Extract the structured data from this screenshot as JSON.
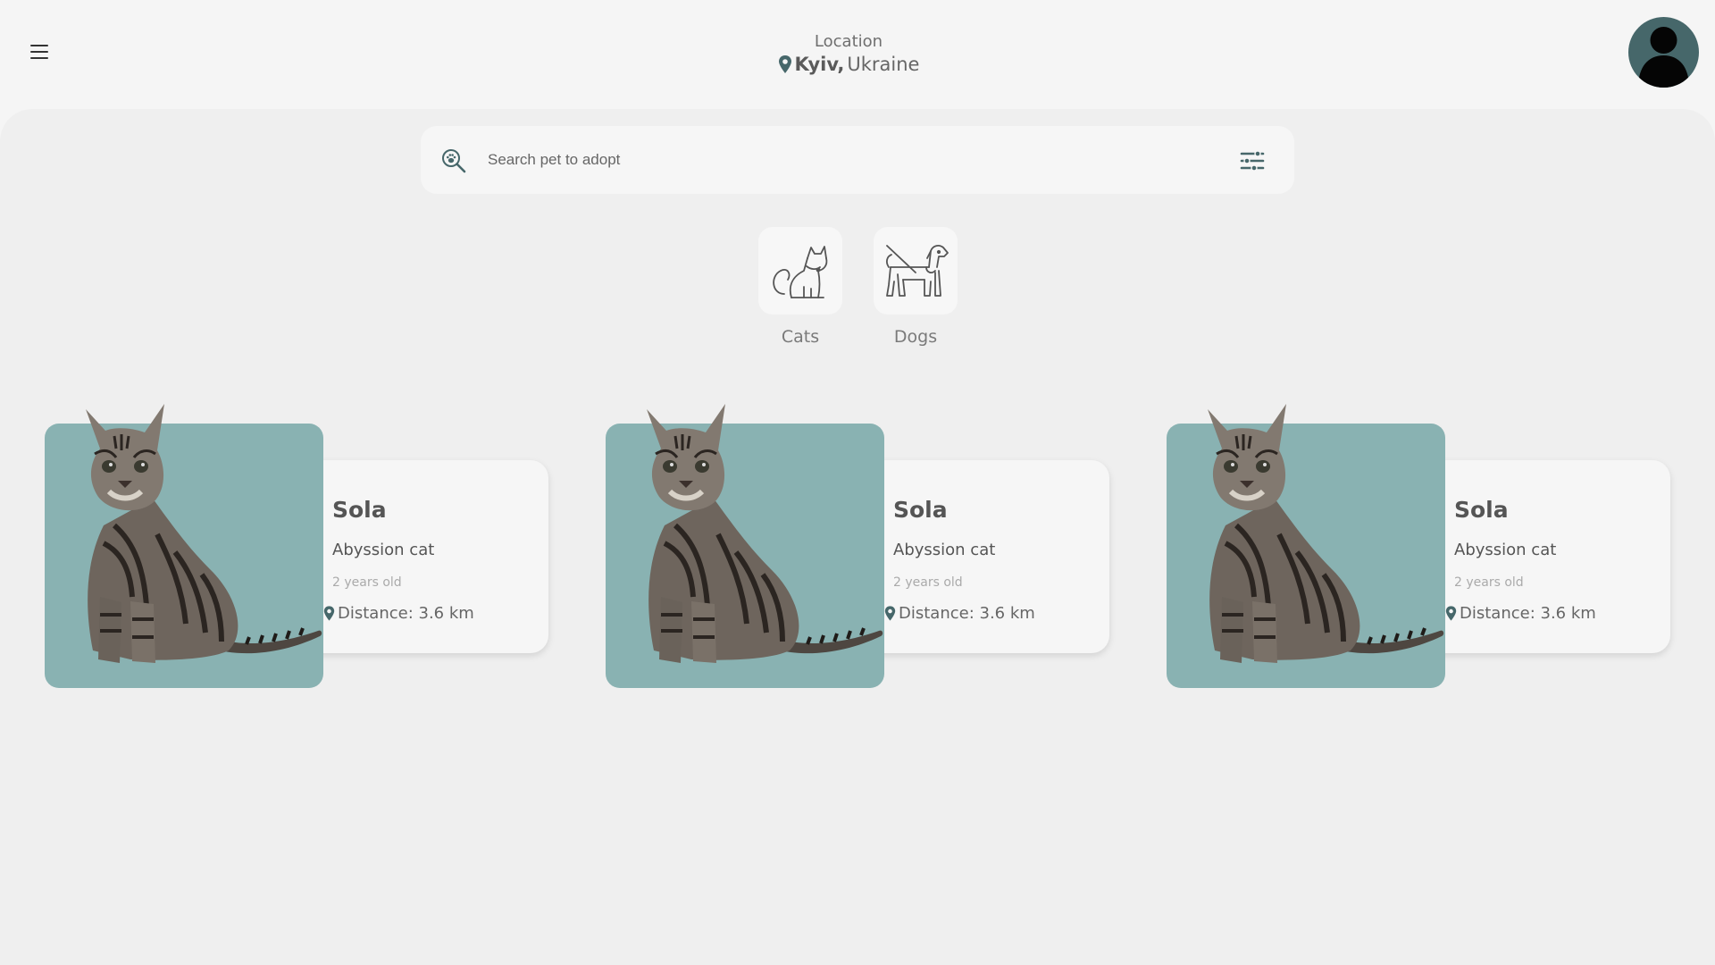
{
  "header": {
    "location_label": "Location",
    "city": "Kyiv,",
    "country": "Ukraine"
  },
  "search": {
    "placeholder": "Search pet to adopt"
  },
  "categories": [
    {
      "label": "Cats",
      "icon": "cat-icon"
    },
    {
      "label": "Dogs",
      "icon": "dog-icon"
    }
  ],
  "pets": [
    {
      "name": "Sola",
      "breed": "Abyssion cat",
      "age": "2 years old",
      "distance": "Distance: 3.6 km"
    },
    {
      "name": "Sola",
      "breed": "Abyssion cat",
      "age": "2 years old",
      "distance": "Distance: 3.6 km"
    },
    {
      "name": "Sola",
      "breed": "Abyssion cat",
      "age": "2 years old",
      "distance": "Distance: 3.6 km"
    }
  ],
  "colors": {
    "accent": "#46676a",
    "card_photo_bg": "#89b2b2",
    "background": "#efefef"
  }
}
